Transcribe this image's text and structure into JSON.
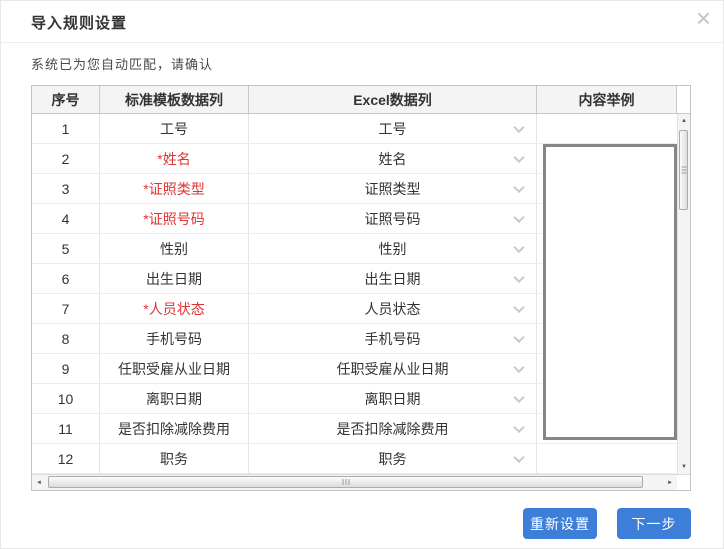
{
  "dialog": {
    "title": "导入规则设置",
    "subtitle": "系统已为您自动匹配，请确认",
    "close_icon": "×"
  },
  "table": {
    "headers": [
      "序号",
      "标准模板数据列",
      "Excel数据列",
      "内容举例"
    ],
    "rows": [
      {
        "no": "1",
        "standard": "工号",
        "required": false,
        "excel": "工号",
        "example": ""
      },
      {
        "no": "2",
        "standard": "*姓名",
        "required": true,
        "excel": "姓名",
        "example": ""
      },
      {
        "no": "3",
        "standard": "*证照类型",
        "required": true,
        "excel": "证照类型",
        "example": ""
      },
      {
        "no": "4",
        "standard": "*证照号码",
        "required": true,
        "excel": "证照号码",
        "example": ""
      },
      {
        "no": "5",
        "standard": "性别",
        "required": false,
        "excel": "性别",
        "example": ""
      },
      {
        "no": "6",
        "standard": "出生日期",
        "required": false,
        "excel": "出生日期",
        "example": ""
      },
      {
        "no": "7",
        "standard": "*人员状态",
        "required": true,
        "excel": "人员状态",
        "example": ""
      },
      {
        "no": "8",
        "standard": "手机号码",
        "required": false,
        "excel": "手机号码",
        "example": ""
      },
      {
        "no": "9",
        "standard": "任职受雇从业日期",
        "required": false,
        "excel": "任职受雇从业日期",
        "example": ""
      },
      {
        "no": "10",
        "standard": "离职日期",
        "required": false,
        "excel": "离职日期",
        "example": ""
      },
      {
        "no": "11",
        "standard": "是否扣除减除费用",
        "required": false,
        "excel": "是否扣除减除费用",
        "example": ""
      },
      {
        "no": "12",
        "standard": "职务",
        "required": false,
        "excel": "职务",
        "example": ""
      }
    ]
  },
  "scrollbars": {
    "up_arrow": "▲",
    "down_arrow": "▼",
    "left_arrow": "◄",
    "right_arrow": "►"
  },
  "footer": {
    "reset_label": "重新设置",
    "next_label": "下一步"
  },
  "colors": {
    "accent_blue": "#3d7ed8",
    "required_red": "#e03333"
  }
}
